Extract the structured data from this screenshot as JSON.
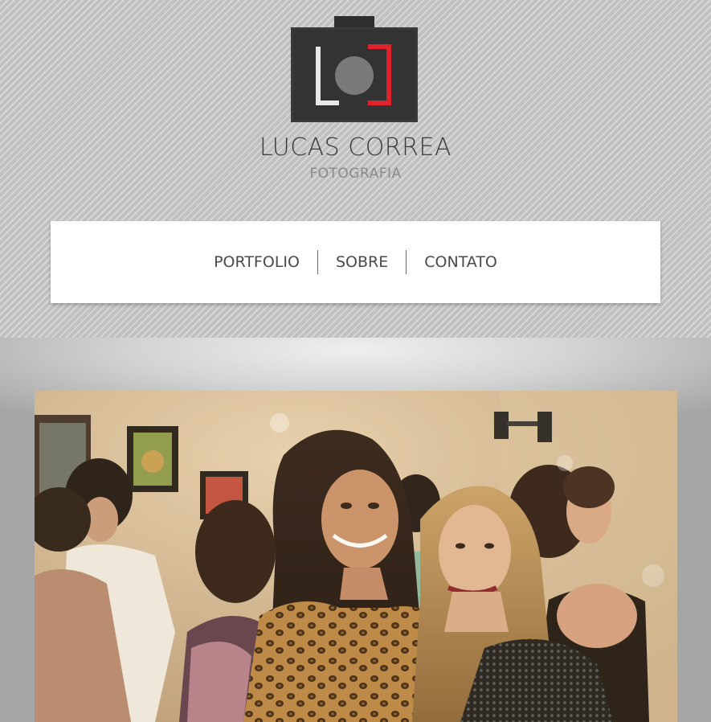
{
  "brand": {
    "name": "LUCAS CORREA",
    "tagline": "FOTOGRAFIA",
    "logo_icon": "camera-logo-icon",
    "accent_color": "#e0222c"
  },
  "nav": {
    "items": [
      {
        "label": "PORTFOLIO"
      },
      {
        "label": "SOBRE"
      },
      {
        "label": "CONTATO"
      }
    ]
  },
  "hero": {
    "image": "party-photo"
  }
}
